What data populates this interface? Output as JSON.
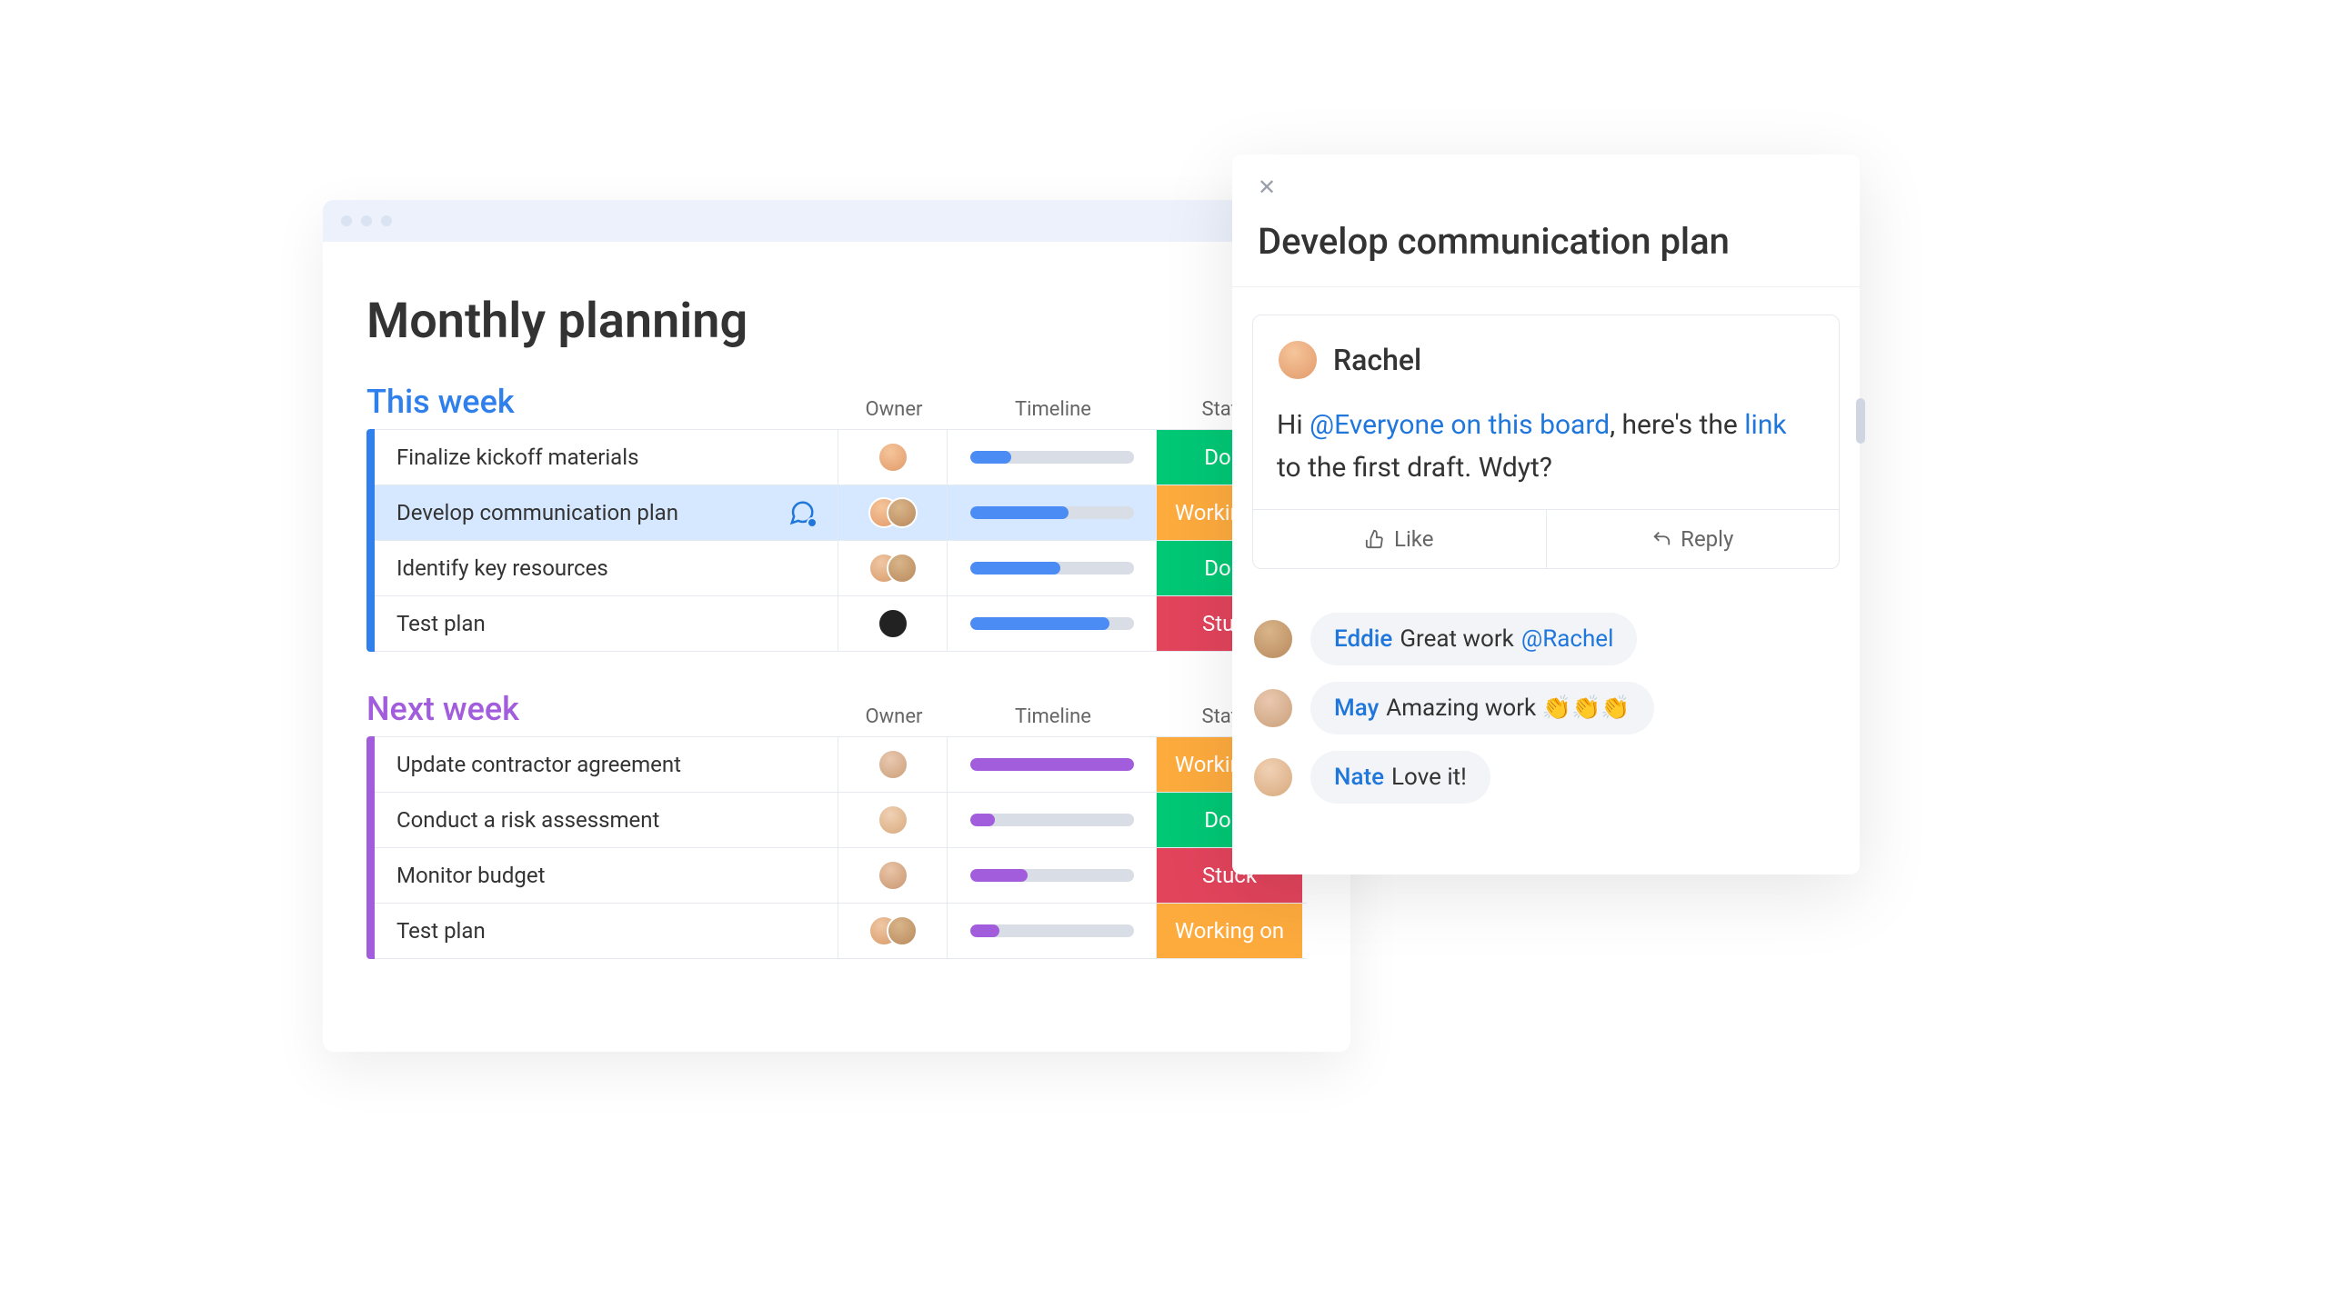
{
  "board": {
    "title": "Monthly planning",
    "columns": {
      "owner": "Owner",
      "timeline": "Timeline",
      "status": "Status"
    },
    "statuses": {
      "done": "Done",
      "working": "Working on",
      "stuck": "Stuck"
    },
    "groups": [
      {
        "id": "this-week",
        "title": "This week",
        "rows": [
          {
            "name": "Finalize kickoff materials",
            "owners": [
              "av1"
            ],
            "progress": 25,
            "status": "done",
            "selected": false,
            "has_thread": false
          },
          {
            "name": "Develop communication plan",
            "owners": [
              "av1",
              "av2"
            ],
            "progress": 60,
            "status": "working",
            "selected": true,
            "has_thread": true
          },
          {
            "name": "Identify key resources",
            "owners": [
              "av3",
              "av2"
            ],
            "progress": 55,
            "status": "done",
            "selected": false,
            "has_thread": false
          },
          {
            "name": "Test plan",
            "owners": [
              "av4"
            ],
            "progress": 85,
            "status": "stuck",
            "selected": false,
            "has_thread": false
          }
        ]
      },
      {
        "id": "next-week",
        "title": "Next week",
        "rows": [
          {
            "name": "Update contractor agreement",
            "owners": [
              "av5"
            ],
            "progress": 100,
            "status": "working",
            "selected": false,
            "has_thread": false
          },
          {
            "name": "Conduct a risk assessment",
            "owners": [
              "av6"
            ],
            "progress": 15,
            "status": "done",
            "selected": false,
            "has_thread": false
          },
          {
            "name": "Monitor budget",
            "owners": [
              "av7"
            ],
            "progress": 35,
            "status": "stuck",
            "selected": false,
            "has_thread": false
          },
          {
            "name": "Test plan",
            "owners": [
              "av3",
              "av2"
            ],
            "progress": 18,
            "status": "working",
            "selected": false,
            "has_thread": false
          }
        ]
      }
    ]
  },
  "panel": {
    "title": "Develop communication plan",
    "actions": {
      "like": "Like",
      "reply": "Reply"
    },
    "post": {
      "author": "Rachel",
      "body_pre": "Hi ",
      "mention": "@Everyone on this board",
      "body_mid": ", here's the ",
      "link_text": "link",
      "body_post": " to the first draft. Wdyt?"
    },
    "replies": [
      {
        "author": "Eddie",
        "text": "Great work ",
        "mention": "@Rachel",
        "tail": "",
        "avatar": "av2"
      },
      {
        "author": "May",
        "text": "Amazing work 👏👏👏",
        "mention": "",
        "tail": "",
        "avatar": "av5"
      },
      {
        "author": "Nate",
        "text": "Love it!",
        "mention": "",
        "tail": "",
        "avatar": "av6"
      }
    ]
  }
}
